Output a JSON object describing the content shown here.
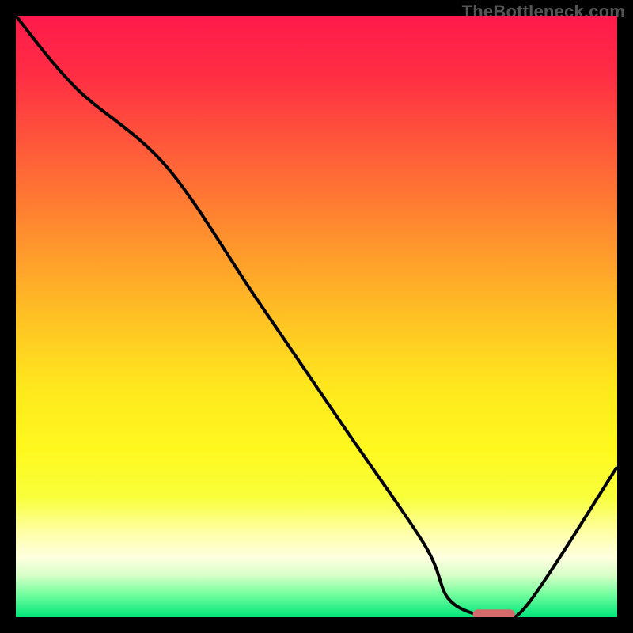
{
  "attribution": "TheBottleneck.com",
  "chart_data": {
    "type": "line",
    "title": "",
    "xlabel": "",
    "ylabel": "",
    "xlim": [
      0,
      100
    ],
    "ylim": [
      0,
      100
    ],
    "curve": {
      "x": [
        0,
        10,
        25,
        40,
        55,
        68,
        72,
        78,
        80,
        85,
        100
      ],
      "y": [
        100,
        88,
        75,
        53,
        31,
        12,
        3,
        0,
        0,
        2,
        25
      ]
    },
    "marker": {
      "x_start": 76,
      "x_end": 83,
      "y": 0.5
    },
    "gradient_stops": [
      {
        "offset": 0.0,
        "color": "#ff1a4b"
      },
      {
        "offset": 0.1,
        "color": "#ff2e44"
      },
      {
        "offset": 0.22,
        "color": "#ff5a3a"
      },
      {
        "offset": 0.35,
        "color": "#ff8a2f"
      },
      {
        "offset": 0.5,
        "color": "#ffc124"
      },
      {
        "offset": 0.62,
        "color": "#ffe81e"
      },
      {
        "offset": 0.72,
        "color": "#fff81f"
      },
      {
        "offset": 0.8,
        "color": "#f8ff3a"
      },
      {
        "offset": 0.86,
        "color": "#ffffa8"
      },
      {
        "offset": 0.9,
        "color": "#ffffe0"
      },
      {
        "offset": 0.93,
        "color": "#d8ffc8"
      },
      {
        "offset": 0.96,
        "color": "#7affa0"
      },
      {
        "offset": 1.0,
        "color": "#00e67a"
      }
    ],
    "marker_color": "#d46a6a",
    "curve_color": "#000000"
  }
}
